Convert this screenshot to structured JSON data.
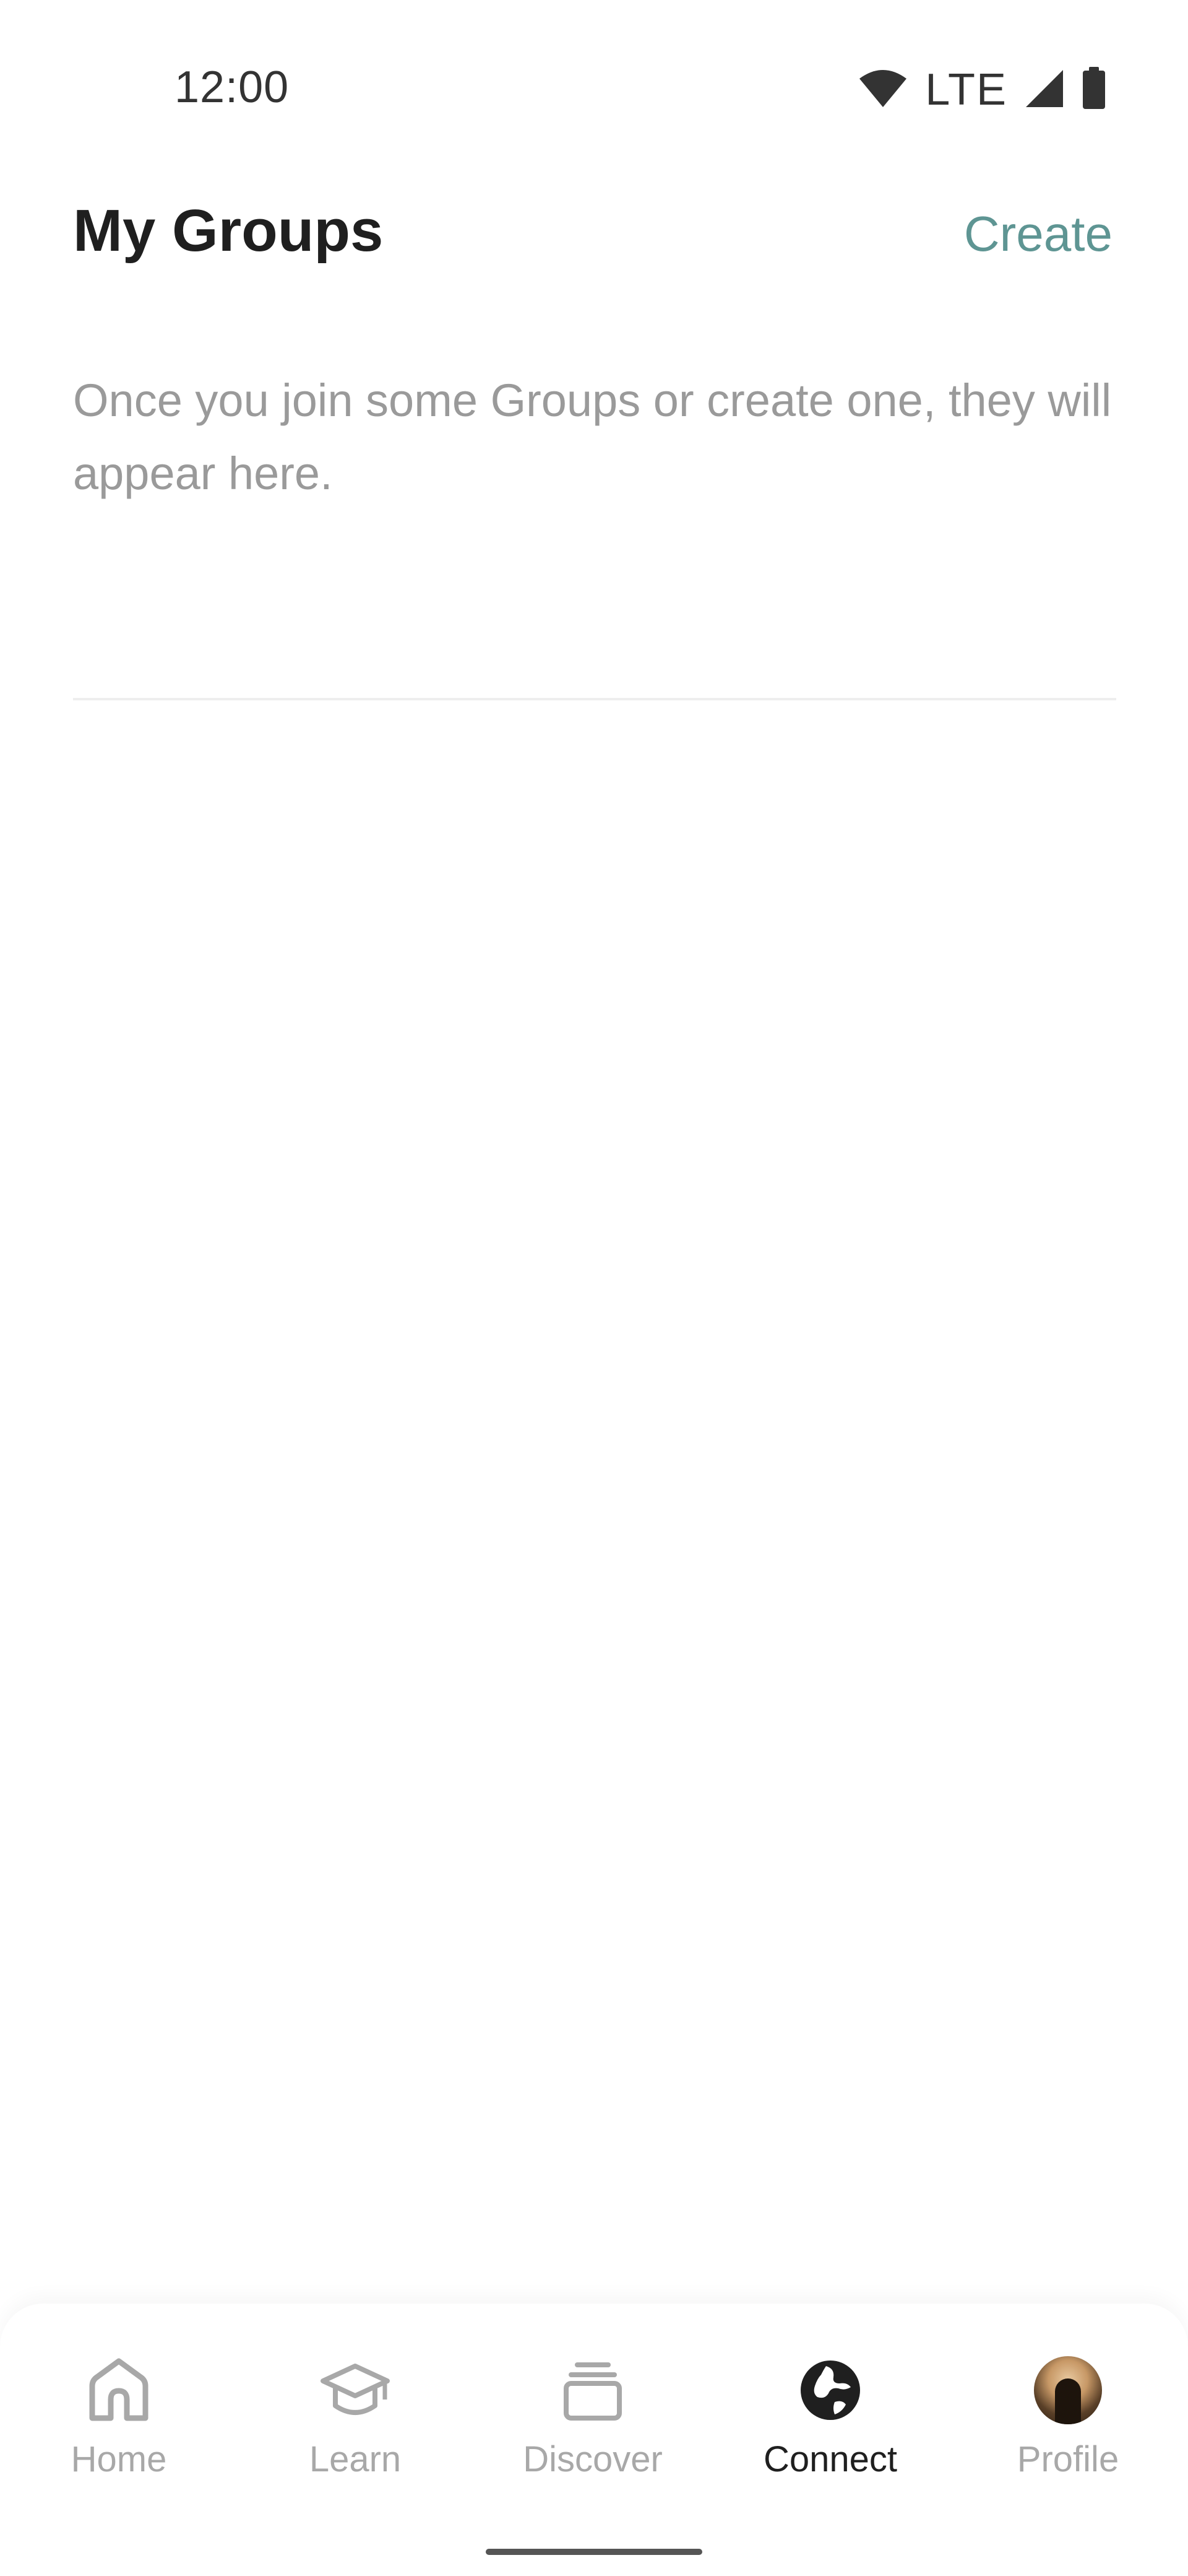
{
  "status_bar": {
    "time": "12:00",
    "network": "LTE"
  },
  "header": {
    "title": "My Groups",
    "create_label": "Create"
  },
  "empty_state": {
    "message": "Once you join some Groups or create one, they will appear here."
  },
  "nav": {
    "items": [
      {
        "label": "Home",
        "icon": "home-icon",
        "active": false
      },
      {
        "label": "Learn",
        "icon": "graduation-cap-icon",
        "active": false
      },
      {
        "label": "Discover",
        "icon": "stack-icon",
        "active": false
      },
      {
        "label": "Connect",
        "icon": "globe-icon",
        "active": true
      },
      {
        "label": "Profile",
        "icon": "avatar",
        "active": false
      }
    ]
  },
  "colors": {
    "accent": "#5e9593",
    "muted_text": "#9a9a9a",
    "active_nav": "#1f1f1f",
    "inactive_nav": "#a8a8a8"
  }
}
